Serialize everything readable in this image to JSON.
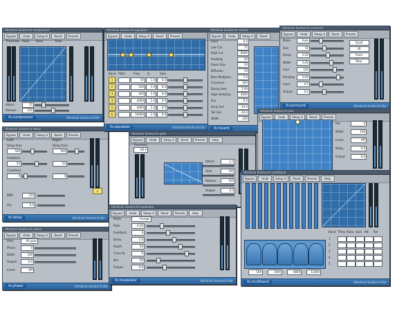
{
  "common": {
    "toolbar": [
      "Bypass",
      "Undo",
      "Setup A",
      "Reset",
      "Presets",
      "Help"
    ],
    "brand": "Ultrafunk Sonitus:fx Bar"
  },
  "windows": {
    "compressor": {
      "name": "fx:compressor",
      "title": "Ultrafunk Sonitus:fx compressor",
      "labels": [
        "Threshold",
        "Ratio",
        "Knee",
        "Peak",
        "Output",
        "Attack",
        "Release"
      ]
    },
    "equalizer": {
      "name": "fx:equalizer",
      "title": "Ultrafunk Sonitus:fx equalizer",
      "cols": [
        "Band",
        "Filter",
        "Freq",
        "Q",
        "Gain"
      ],
      "bands": [
        "1",
        "2",
        "3",
        "4",
        "5",
        "6"
      ],
      "freqs": [
        "50",
        "100",
        "400",
        "2000",
        "6000",
        "16000"
      ],
      "q": [
        "1.0",
        "1.0",
        "1.0",
        "1.0",
        "1.0",
        "1.0"
      ],
      "gain": [
        "0.0",
        "0.0",
        "0.0",
        "0.0",
        "0.0",
        "0.0"
      ]
    },
    "reverb": {
      "name": "fx:reverb",
      "title": "Ultrafunk Sonitus:fx reverb",
      "labels": [
        "Input",
        "Low Cut",
        "High Cut",
        "Predelay",
        "Room Size",
        "Diffusion",
        "Bass Multiplier",
        "Crossover",
        "Decay time",
        "High damping",
        "Dry",
        "Early Out",
        "Tail Out",
        "Width"
      ],
      "values": [
        "0.0",
        "75",
        "8000",
        "40",
        "50",
        "50",
        "1.0",
        "500",
        "2.00",
        "4000",
        "0.0",
        "-10.0",
        "-10.0",
        "100"
      ]
    },
    "surround": {
      "name": "fx:surround",
      "title": "Ultrafunk Sonitus:fx surround",
      "labels": [
        "Mode",
        "Size",
        "Damp",
        "Width",
        "Gain",
        "Predelay",
        "Input",
        "Output"
      ],
      "values": [
        "Auto",
        "50",
        "0.50",
        "0.00",
        "100",
        "0.00",
        "0.0",
        "0.0"
      ],
      "modes": [
        "Quad",
        "LR",
        "Front",
        "Rear"
      ]
    },
    "delay": {
      "name": "fx:delay",
      "title": "Ultrafunk Sonitus:fx delay",
      "left": "Left",
      "right": "Right",
      "labels": [
        "Delay time",
        "Feedback",
        "Crossfeed",
        "Dry"
      ],
      "values": [
        "500",
        "50",
        "0",
        "0.0"
      ],
      "tempo": "120",
      "bpm": "BPM"
    },
    "gate": {
      "name": "fx:gate",
      "title": "Ultrafunk Sonitus:fx gate",
      "labels": [
        "Threshold",
        "Attack",
        "Hold",
        "Release",
        "Output"
      ],
      "values": [
        "-40.0",
        "1.0",
        "100",
        "100",
        "0.0"
      ]
    },
    "pan": {
      "name": "fx:pan",
      "title": "Ultrafunk Sonitus:fx pan",
      "labels": [
        "Pan",
        "Width",
        "Invert",
        "Delay",
        "Output"
      ],
      "values": [
        "0",
        "100",
        "Off",
        "0.0",
        "0.0"
      ]
    },
    "phase": {
      "name": "fx:phase",
      "title": "Ultrafunk Sonitus:fx phase",
      "labels": [
        "Filter",
        "Phase",
        "Width",
        "Output",
        "Invert"
      ],
      "values": [
        "All pass",
        "0",
        "100",
        "0.0",
        "Off"
      ]
    },
    "modulator": {
      "name": "fx:modulator",
      "title": "Ultrafunk Sonitus:fx modulator",
      "labels": [
        "Mode",
        "Rate",
        "Feedback",
        "Delay",
        "Depth",
        "Cross fb",
        "Mix",
        "Output"
      ],
      "values": [
        "Flanger",
        "0.50",
        "0",
        "1.0",
        "50",
        "0",
        "50",
        "0.0"
      ]
    },
    "multiband": {
      "name": "fx:multiband",
      "title": "Ultrafunk Sonitus:fx multiband",
      "cols": [
        "Band",
        "Thres",
        "Ratio",
        "Gain",
        "Att",
        "Rel"
      ],
      "rows": [
        "1",
        "2",
        "3",
        "4",
        "5"
      ],
      "freqs": [
        "160",
        "1000",
        "4800",
        "12000"
      ]
    }
  },
  "colors": {
    "accent": "#2f6ca8",
    "footer": "#2a5f96",
    "panel": "#b9bfc6",
    "knob": "#f2e07a"
  }
}
